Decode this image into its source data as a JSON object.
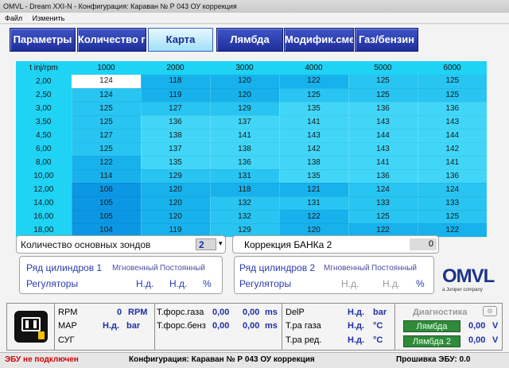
{
  "window": {
    "title": "OMVL - Dream XXI-N - Конфигурация: Караван № Р 043 ОУ коррекция"
  },
  "menu": [
    "Файл",
    "Изменить"
  ],
  "tabs": [
    {
      "label": "Параметры"
    },
    {
      "label": "Количество газа"
    },
    {
      "label": "Карта"
    },
    {
      "label": "Лямбда"
    },
    {
      "label": "Модифик.смеси"
    },
    {
      "label": "Газ/бензин"
    }
  ],
  "map": {
    "corner": "t inj/rpm",
    "rpm": [
      "1000",
      "2000",
      "3000",
      "4000",
      "5000",
      "6000"
    ],
    "rows": [
      {
        "tinj": "2,00",
        "v": [
          "124",
          "118",
          "120",
          "122",
          "125",
          "125"
        ]
      },
      {
        "tinj": "2,50",
        "v": [
          "124",
          "119",
          "120",
          "125",
          "125",
          "125"
        ]
      },
      {
        "tinj": "3,00",
        "v": [
          "125",
          "127",
          "129",
          "135",
          "136",
          "136"
        ]
      },
      {
        "tinj": "3,50",
        "v": [
          "125",
          "136",
          "137",
          "141",
          "143",
          "143"
        ]
      },
      {
        "tinj": "4,50",
        "v": [
          "127",
          "138",
          "141",
          "143",
          "144",
          "144"
        ]
      },
      {
        "tinj": "6,00",
        "v": [
          "125",
          "137",
          "138",
          "142",
          "143",
          "142"
        ]
      },
      {
        "tinj": "8,00",
        "v": [
          "122",
          "135",
          "136",
          "138",
          "141",
          "141"
        ]
      },
      {
        "tinj": "10,00",
        "v": [
          "114",
          "129",
          "131",
          "135",
          "136",
          "136"
        ]
      },
      {
        "tinj": "12,00",
        "v": [
          "106",
          "120",
          "118",
          "121",
          "124",
          "124"
        ]
      },
      {
        "tinj": "14,00",
        "v": [
          "105",
          "120",
          "132",
          "131",
          "133",
          "133"
        ]
      },
      {
        "tinj": "16,00",
        "v": [
          "105",
          "120",
          "132",
          "122",
          "125",
          "125"
        ]
      },
      {
        "tinj": "18,00",
        "v": [
          "104",
          "119",
          "129",
          "120",
          "122",
          "122"
        ]
      }
    ]
  },
  "sensors": {
    "label": "Количество основных зондов",
    "value": "2"
  },
  "bank": {
    "label": "Коррекция БАНКа 2",
    "value": "0"
  },
  "cyl1": {
    "title": "Ряд цилиндров 1",
    "instant": "Мгновенный",
    "constant": "Постоянный",
    "reg": "Регуляторы",
    "v1": "Н.д.",
    "v2": "Н.д.",
    "pct": "%"
  },
  "cyl2": {
    "title": "Ряд цилиндров 2",
    "instant": "Мгновенный",
    "constant": "Постоянный",
    "reg": "Регуляторы",
    "v1": "Н.д.",
    "v2": "Н.д.",
    "pct": "%"
  },
  "logo": {
    "text": "OMVL",
    "sub": "a Juniper company"
  },
  "bottom": {
    "rpm_label": "RPM",
    "rpm_value": "0",
    "rpm_unit": "RPM",
    "map_label": "MAP",
    "map_value": "Н.д.",
    "map_unit": "bar",
    "syg_label": "СУГ",
    "tgas_label": "Т.форс.газа",
    "tgas_v1": "0,00",
    "tgas_v2": "0,00",
    "tgas_unit": "ms",
    "tpet_label": "Т.форс.бенз",
    "tpet_v1": "0,00",
    "tpet_v2": "0,00",
    "tpet_unit": "ms",
    "delp_label": "DelP",
    "delp_value": "Н.д.",
    "delp_unit": "bar",
    "trgas_label": "Т.ра газа",
    "trgas_value": "Н.д.",
    "trgas_unit": "°C",
    "trred_label": "Т.ра ред.",
    "trred_value": "Н.д.",
    "trred_unit": "°C",
    "diag_label": "Диагностика",
    "lambda1_label": "Лямбда",
    "lambda1_value": "0,00",
    "lambda1_unit": "V",
    "lambda2_label": "Лямбда 2",
    "lambda2_value": "0,00",
    "lambda2_unit": "V"
  },
  "status": {
    "ecu": "ЭБУ не подключен",
    "config": "Конфигурация: Караван № Р 043 ОУ коррекция",
    "firmware": "Прошивка ЭБУ: 0.0"
  },
  "colors": {
    "tab": "#2a3cb0",
    "cell_dark": "#0c97e4",
    "cell_light": "#41d6f8",
    "header": "#1ed3f4",
    "ecu_status": "#d00000"
  }
}
